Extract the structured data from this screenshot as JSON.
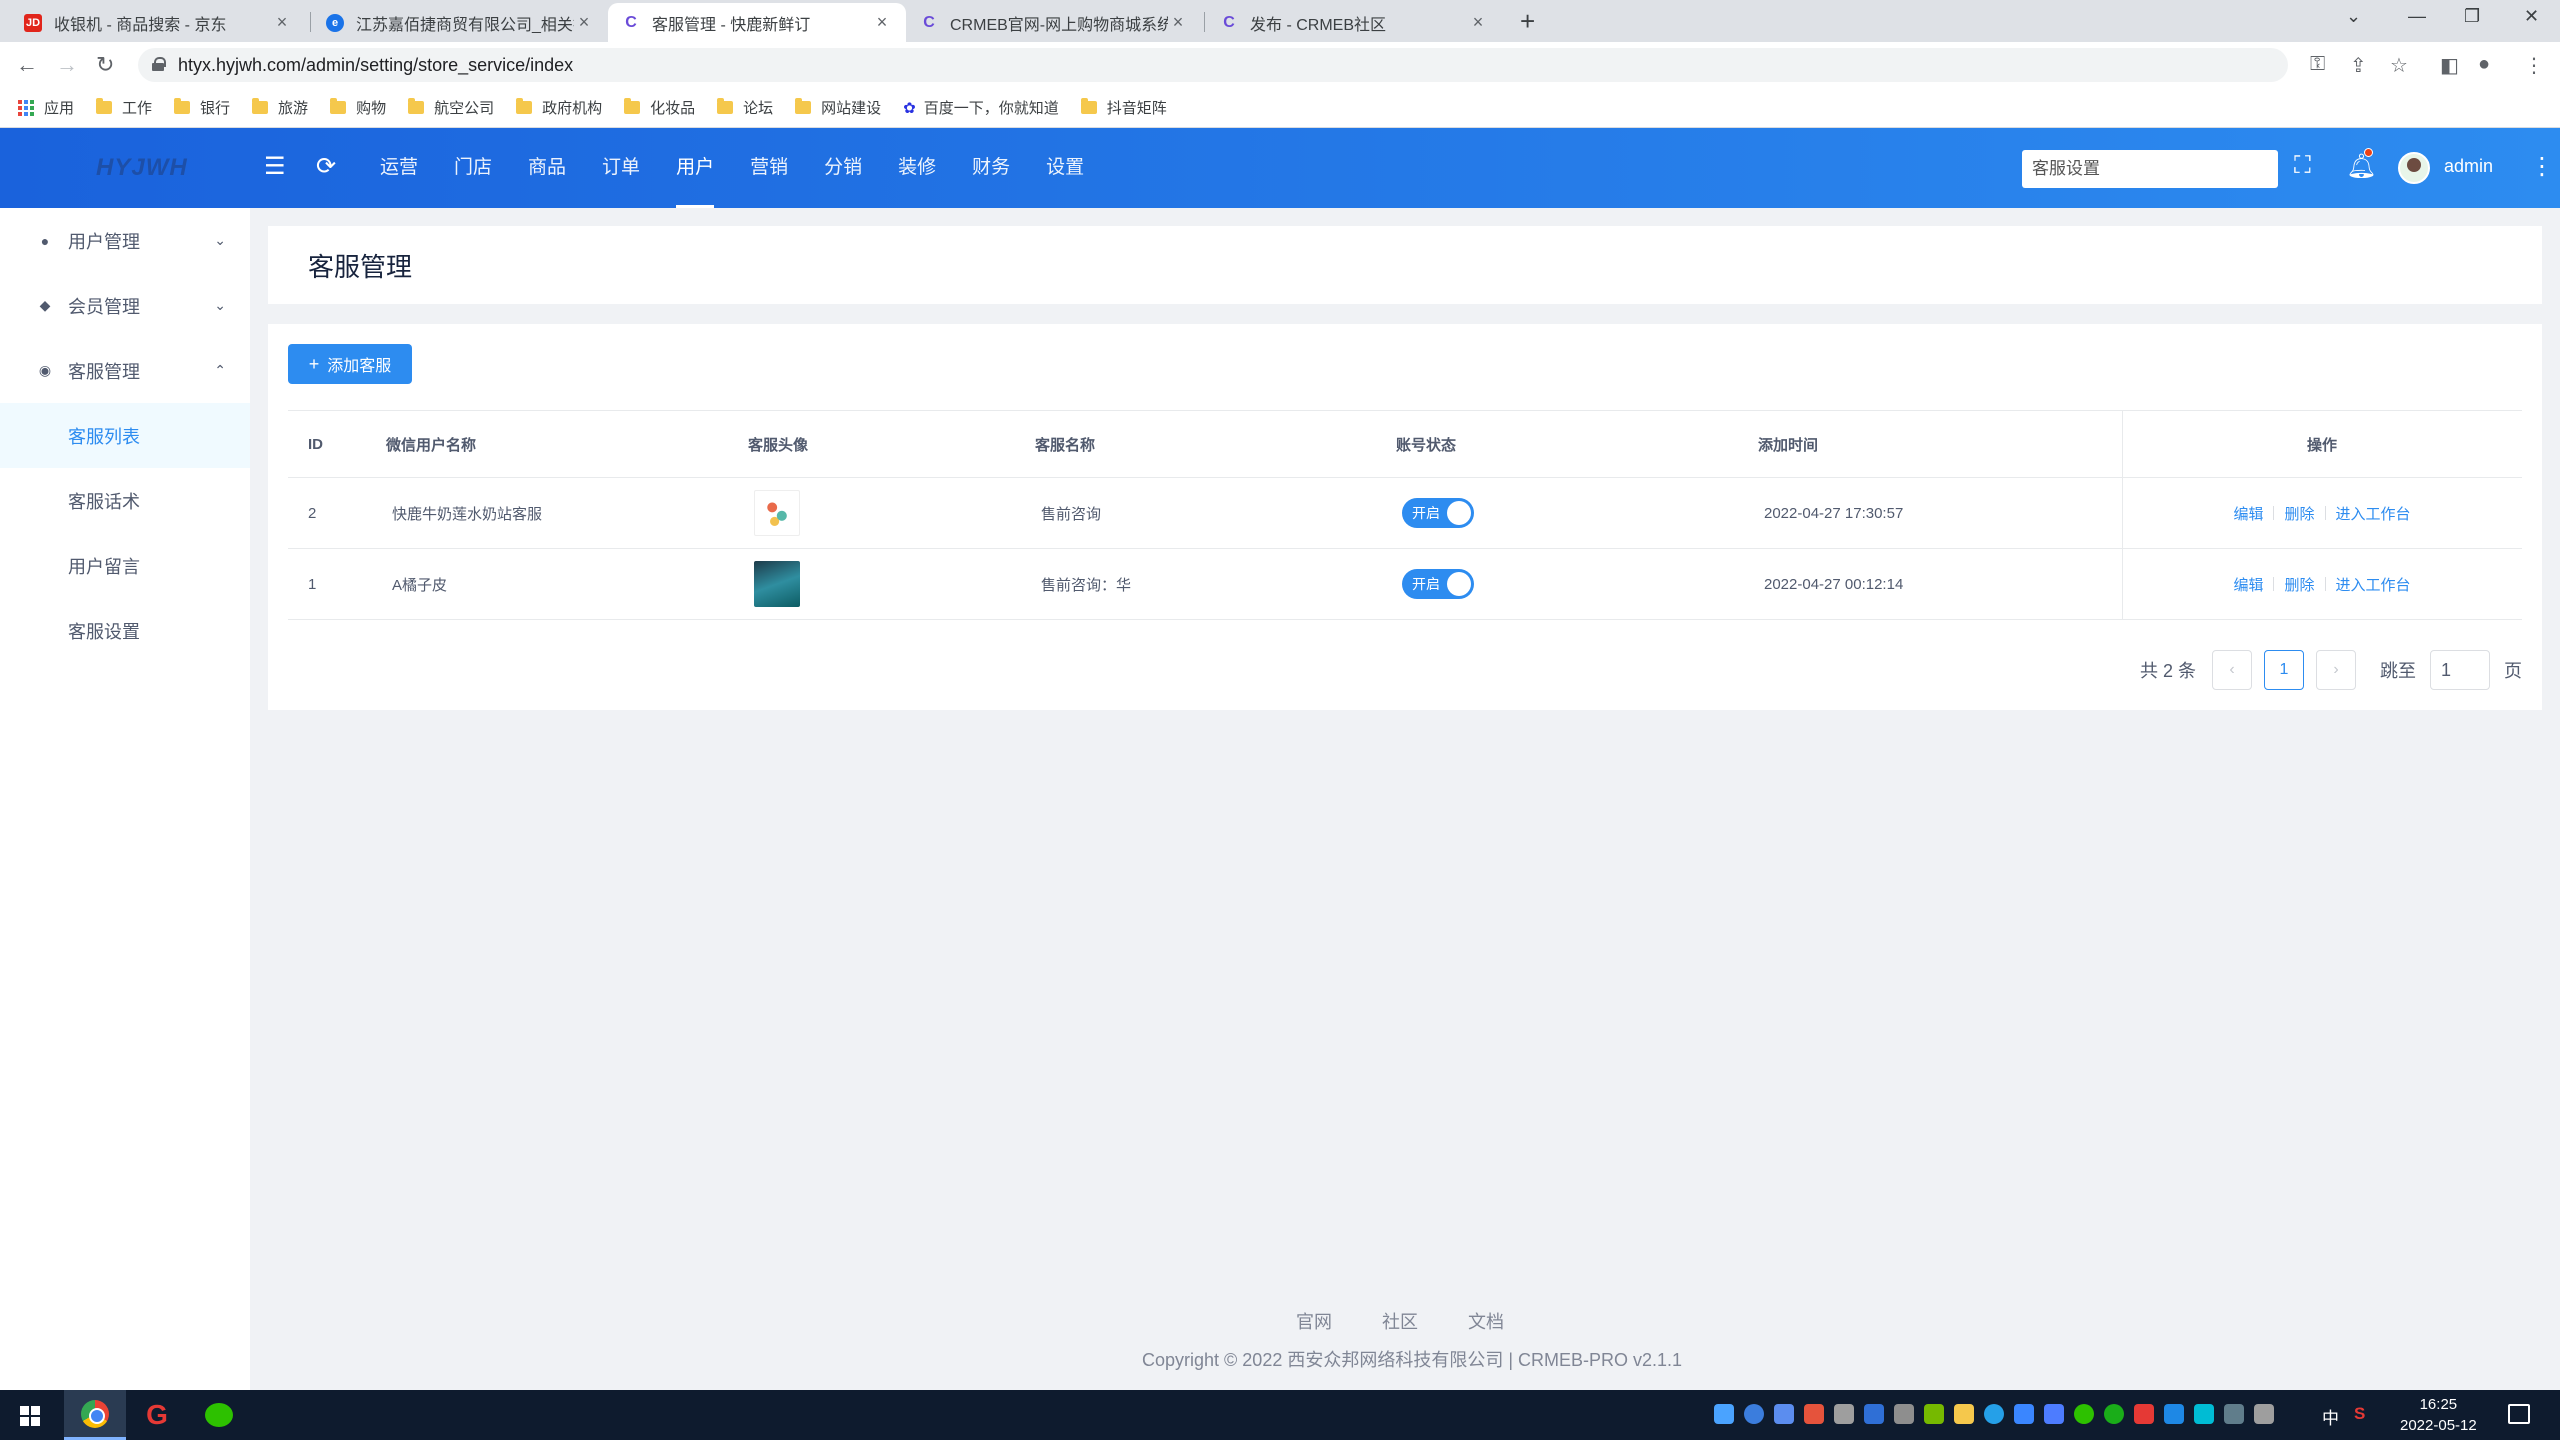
{
  "browser": {
    "tabs": [
      {
        "title": "收银机 - 商品搜索 - 京东",
        "favicon": "JD",
        "active": false
      },
      {
        "title": "江苏嘉佰捷商贸有限公司_相关搜",
        "favicon": "e",
        "active": false
      },
      {
        "title": "客服管理 - 快鹿新鲜订",
        "favicon": "C",
        "active": true
      },
      {
        "title": "CRMEB官网-网上购物商城系统",
        "favicon": "C",
        "active": false
      },
      {
        "title": "发布 - CRMEB社区",
        "favicon": "C",
        "active": false
      }
    ],
    "url": "htyx.hyjwh.com/admin/setting/store_service/index",
    "bookmarks": [
      "应用",
      "工作",
      "银行",
      "旅游",
      "购物",
      "航空公司",
      "政府机构",
      "化妆品",
      "论坛",
      "网站建设",
      "百度一下，你就知道",
      "抖音矩阵"
    ]
  },
  "header": {
    "logo": "HYJWH",
    "nav": [
      "运营",
      "门店",
      "商品",
      "订单",
      "用户",
      "营销",
      "分销",
      "装修",
      "财务",
      "设置"
    ],
    "active_nav": "用户",
    "search_value": "客服设置",
    "username": "admin"
  },
  "sidebar": {
    "groups": [
      {
        "label": "用户管理",
        "icon": "user-icon",
        "expanded": false
      },
      {
        "label": "会员管理",
        "icon": "member-icon",
        "expanded": false
      },
      {
        "label": "客服管理",
        "icon": "chat-icon",
        "expanded": true
      }
    ],
    "items": [
      "客服列表",
      "客服话术",
      "用户留言",
      "客服设置"
    ],
    "active_item": "客服列表"
  },
  "page": {
    "title": "客服管理",
    "add_button": "添加客服"
  },
  "table": {
    "columns": [
      "ID",
      "微信用户名称",
      "客服头像",
      "客服名称",
      "账号状态",
      "添加时间",
      "操作"
    ],
    "rows": [
      {
        "id": "2",
        "wechat_name": "快鹿牛奶莲水奶站客服",
        "service_name": "售前咨询",
        "status": "开启",
        "added": "2022-04-27 17:30:57"
      },
      {
        "id": "1",
        "wechat_name": "A橘子皮",
        "service_name": "售前咨询：华",
        "status": "开启",
        "added": "2022-04-27 00:12:14"
      }
    ],
    "actions": [
      "编辑",
      "删除",
      "进入工作台"
    ]
  },
  "pagination": {
    "total_text": "共 2 条",
    "current_page": "1",
    "jump_label": "跳至",
    "jump_value": "1",
    "page_suffix": "页"
  },
  "footer": {
    "links": [
      "官网",
      "社区",
      "文档"
    ],
    "copyright": "Copyright © 2022 西安众邦网络科技有限公司 | CRMEB-PRO v2.1.1"
  },
  "taskbar": {
    "ime": "中",
    "time": "16:25",
    "date": "2022-05-12"
  },
  "colors": {
    "primary": "#2d8cf0",
    "header_start": "#1a62dc",
    "header_end": "#2d8cf0"
  }
}
